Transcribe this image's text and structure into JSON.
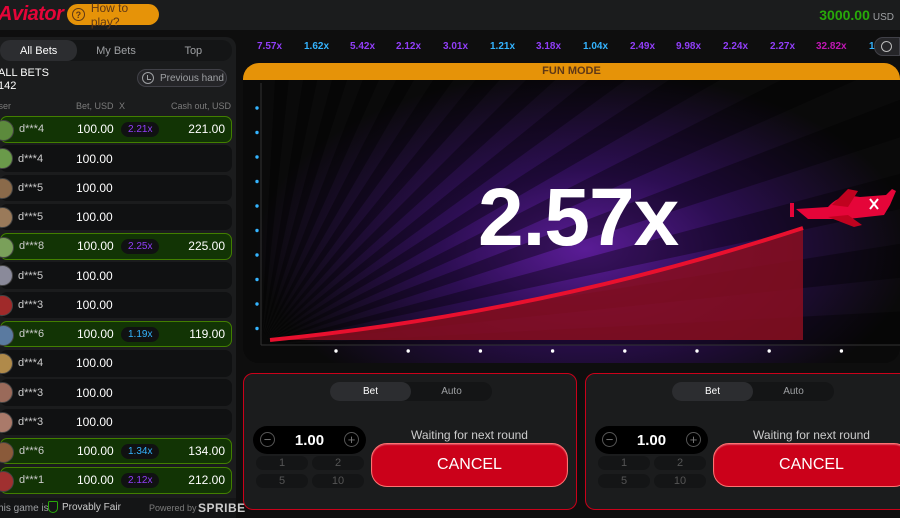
{
  "header": {
    "logo": "Aviator",
    "how_to_play": "How to play?",
    "balance": "3000.00",
    "currency": "USD"
  },
  "left_panel": {
    "tabs": [
      {
        "label": "All Bets",
        "active": true
      },
      {
        "label": "My Bets",
        "active": false
      },
      {
        "label": "Top",
        "active": false
      }
    ],
    "title": "ALL BETS",
    "count": "142",
    "previous_hand": "Previous hand",
    "columns": {
      "user": "User",
      "bet": "Bet, USD",
      "x": "X",
      "cashout": "Cash out, USD"
    },
    "rows": [
      {
        "user": "d***4",
        "bet": "100.00",
        "x": "2.21x",
        "cashout": "221.00",
        "win": true,
        "mult_color": "purple",
        "avatar": "#5c8a3c"
      },
      {
        "user": "d***4",
        "bet": "100.00",
        "x": "",
        "cashout": "",
        "win": false,
        "mult_color": "",
        "avatar": "#6a9a4a"
      },
      {
        "user": "d***5",
        "bet": "100.00",
        "x": "",
        "cashout": "",
        "win": false,
        "mult_color": "",
        "avatar": "#8a6a4a"
      },
      {
        "user": "d***5",
        "bet": "100.00",
        "x": "",
        "cashout": "",
        "win": false,
        "mult_color": "",
        "avatar": "#9a7a5a"
      },
      {
        "user": "d***8",
        "bet": "100.00",
        "x": "2.25x",
        "cashout": "225.00",
        "win": true,
        "mult_color": "purple",
        "avatar": "#7aa05a"
      },
      {
        "user": "d***5",
        "bet": "100.00",
        "x": "",
        "cashout": "",
        "win": false,
        "mult_color": "",
        "avatar": "#8a8a9a"
      },
      {
        "user": "d***3",
        "bet": "100.00",
        "x": "",
        "cashout": "",
        "win": false,
        "mult_color": "",
        "avatar": "#a02a2a"
      },
      {
        "user": "d***6",
        "bet": "100.00",
        "x": "1.19x",
        "cashout": "119.00",
        "win": true,
        "mult_color": "blue",
        "avatar": "#5a7aa0"
      },
      {
        "user": "d***4",
        "bet": "100.00",
        "x": "",
        "cashout": "",
        "win": false,
        "mult_color": "",
        "avatar": "#b08a4a"
      },
      {
        "user": "d***3",
        "bet": "100.00",
        "x": "",
        "cashout": "",
        "win": false,
        "mult_color": "",
        "avatar": "#9a6a5a"
      },
      {
        "user": "d***3",
        "bet": "100.00",
        "x": "",
        "cashout": "",
        "win": false,
        "mult_color": "",
        "avatar": "#aa7a6a"
      },
      {
        "user": "d***6",
        "bet": "100.00",
        "x": "1.34x",
        "cashout": "134.00",
        "win": true,
        "mult_color": "blue",
        "avatar": "#8a5a3a"
      },
      {
        "user": "d***1",
        "bet": "100.00",
        "x": "2.12x",
        "cashout": "212.00",
        "win": true,
        "mult_color": "purple",
        "avatar": "#a03030"
      }
    ],
    "footer": {
      "this_game_is": "This game is",
      "provably_fair": "Provably Fair",
      "powered_by": "Powered by",
      "brand": "SPRIBE"
    }
  },
  "history": [
    {
      "v": "7.57x",
      "c": "purple"
    },
    {
      "v": "1.62x",
      "c": "blue"
    },
    {
      "v": "5.42x",
      "c": "purple"
    },
    {
      "v": "2.12x",
      "c": "purple"
    },
    {
      "v": "3.01x",
      "c": "purple"
    },
    {
      "v": "1.21x",
      "c": "blue"
    },
    {
      "v": "3.18x",
      "c": "purple"
    },
    {
      "v": "1.04x",
      "c": "blue"
    },
    {
      "v": "2.49x",
      "c": "purple"
    },
    {
      "v": "9.98x",
      "c": "purple"
    },
    {
      "v": "2.24x",
      "c": "purple"
    },
    {
      "v": "2.27x",
      "c": "purple"
    },
    {
      "v": "32.82x",
      "c": "pink"
    },
    {
      "v": "1",
      "c": "blue"
    }
  ],
  "game": {
    "mode_banner": "FUN MODE",
    "multiplier": "2.57x"
  },
  "bet_panels": [
    {
      "toggle": [
        "Bet",
        "Auto"
      ],
      "amount": "1.00",
      "quick": [
        "1",
        "2",
        "5",
        "10"
      ],
      "waiting": "Waiting for next round",
      "button": "CANCEL"
    },
    {
      "toggle": [
        "Bet",
        "Auto"
      ],
      "amount": "1.00",
      "quick": [
        "1",
        "2",
        "5",
        "10"
      ],
      "waiting": "Waiting for next round",
      "button": "CANCEL"
    }
  ],
  "colors": {
    "accent_red": "#cb011a",
    "win_green": "#28a909",
    "orange": "#e69308",
    "purple": "#913ef8",
    "blue": "#34b4ff",
    "pink": "#c017b4"
  }
}
